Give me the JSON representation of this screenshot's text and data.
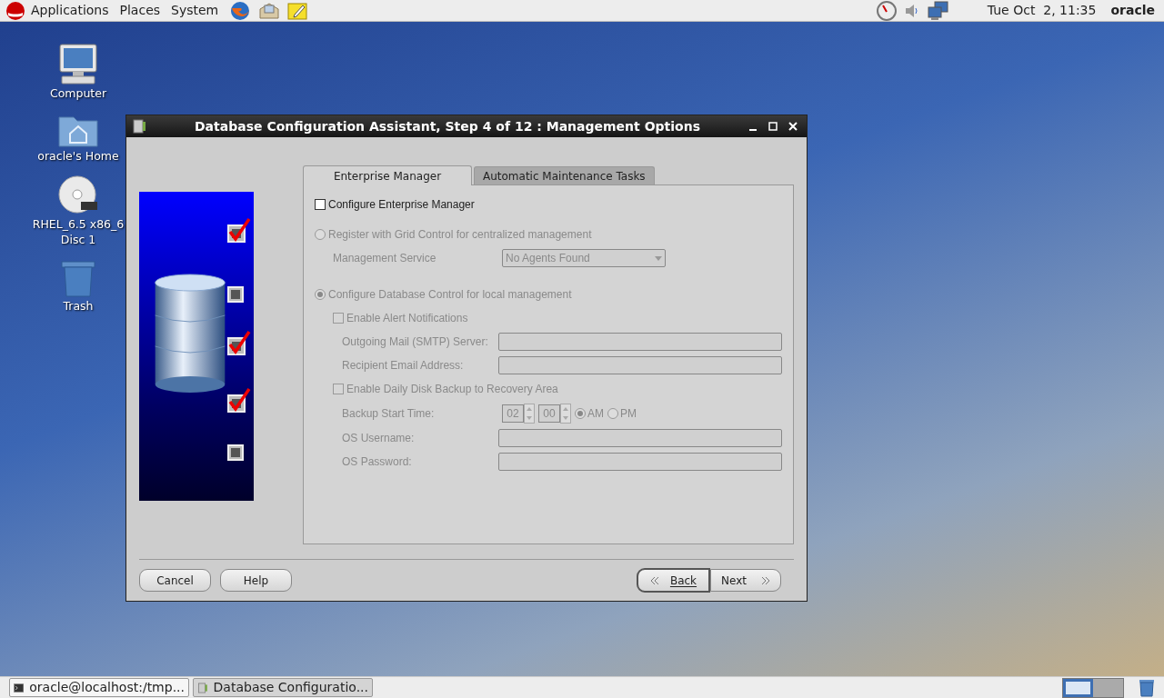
{
  "top_panel": {
    "menus": [
      "Applications",
      "Places",
      "System"
    ],
    "clock": "Tue Oct  2, 11:35",
    "user": "oracle"
  },
  "desktop_icons": [
    {
      "kind": "computer",
      "lines": [
        "Computer"
      ]
    },
    {
      "kind": "home",
      "lines": [
        "oracle's Home"
      ]
    },
    {
      "kind": "dvd",
      "lines": [
        "RHEL_6.5 x86_6",
        "Disc 1"
      ]
    },
    {
      "kind": "trash",
      "lines": [
        "Trash"
      ]
    }
  ],
  "dialog": {
    "title": "Database Configuration Assistant, Step 4 of 12 : Management Options",
    "steps": [
      {
        "checked": true
      },
      {
        "checked": false
      },
      {
        "checked": true
      },
      {
        "checked": true
      },
      {
        "checked": false
      }
    ],
    "tabs": [
      {
        "label": "Enterprise Manager",
        "selected": true
      },
      {
        "label": "Automatic Maintenance Tasks",
        "selected": false
      }
    ],
    "configure_em": {
      "label": "Configure Enterprise Manager",
      "checked": false
    },
    "options_disabled": true,
    "rows": [
      {
        "kind": "radio",
        "label": "Register with Grid Control for centralized management",
        "selected": false
      },
      {
        "kind": "select",
        "label": "Management Service",
        "value": "No Agents Found"
      },
      {
        "kind": "radio",
        "label": "Configure Database Control for local management",
        "selected": true
      },
      {
        "kind": "checkbox",
        "label": "Enable Alert Notifications",
        "checked": false
      },
      {
        "kind": "field",
        "label": "Outgoing Mail (SMTP) Server:"
      },
      {
        "kind": "field",
        "label": "Recipient Email Address:"
      },
      {
        "kind": "checkbox",
        "label": "Enable Daily Disk Backup to Recovery Area",
        "checked": false
      },
      {
        "kind": "time",
        "label": "Backup Start Time:",
        "hour": "02",
        "minute": "00",
        "periods": [
          {
            "label": "AM",
            "selected": true
          },
          {
            "label": "PM",
            "selected": false
          }
        ]
      },
      {
        "kind": "field",
        "label": "OS Username:"
      },
      {
        "kind": "field",
        "label": "OS Password:"
      }
    ],
    "left_buttons": [
      "Cancel",
      "Help"
    ],
    "back": "Back",
    "next": "Next"
  },
  "taskbar": {
    "tasks": [
      {
        "kind": "terminal",
        "label": "oracle@localhost:/tmp...",
        "selected": false
      },
      {
        "kind": "database",
        "label": "Database Configuratio...",
        "selected": true
      }
    ],
    "workspaces": [
      {
        "selected": true
      },
      {
        "selected": false
      }
    ]
  }
}
